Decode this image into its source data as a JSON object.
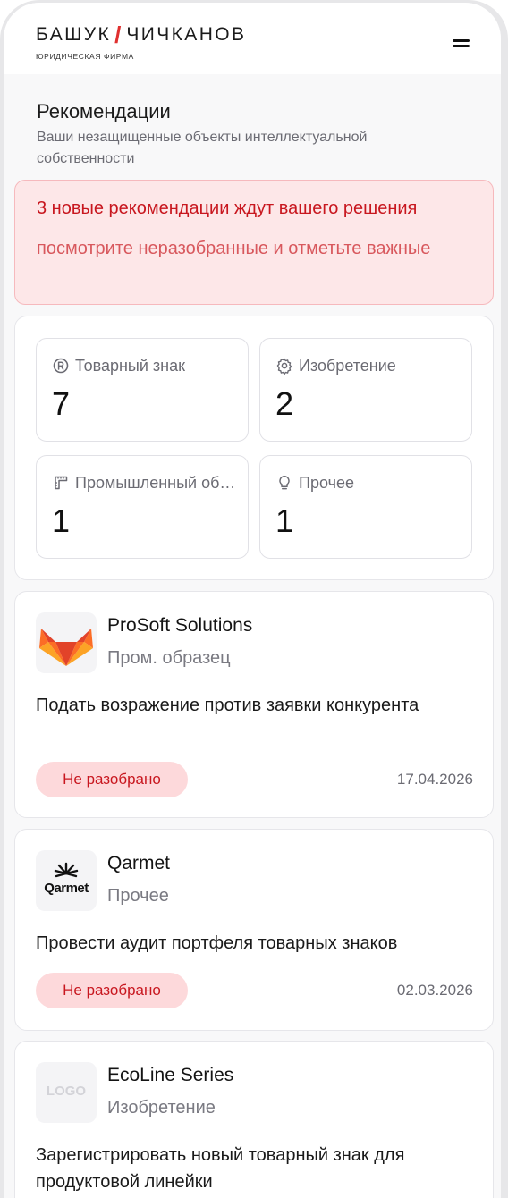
{
  "header": {
    "brand_left": "БАШУК",
    "brand_slash": "/",
    "brand_right": "ЧИЧКАНОВ",
    "brand_tagline": "ЮРИДИЧЕСКАЯ ФИРМА"
  },
  "page": {
    "title": "Рекомендации",
    "subtitle": "Ваши незащищенные объекты интеллектуальной собственности"
  },
  "alert": {
    "title": "3 новые рекомендации ждут вашего решения",
    "text": "посмотрите неразобранные и отметьте важные"
  },
  "stats": [
    {
      "icon": "registered-icon",
      "label": "Товарный знак",
      "value": "7"
    },
    {
      "icon": "gear-icon",
      "label": "Изобретение",
      "value": "2"
    },
    {
      "icon": "ruler-square-icon",
      "label": "Промышленный образец",
      "value": "1"
    },
    {
      "icon": "lightbulb-icon",
      "label": "Прочее",
      "value": "1"
    }
  ],
  "recommendations": [
    {
      "company": "ProSoft Solutions",
      "category": "Пром. образец",
      "description": "Подать возражение против заявки конкурента",
      "status": "Не разобрано",
      "date": "17.04.2026",
      "logo": "fox-logo"
    },
    {
      "company": "Qarmet",
      "logo_text": "Qarmet",
      "category": "Прочее",
      "description": "Провести аудит портфеля товарных знаков",
      "status": "Не разобрано",
      "date": "02.03.2026",
      "logo": "qarmet-logo"
    },
    {
      "company": "EcoLine Series",
      "logo_text": "LOGO",
      "category": "Изобретение",
      "description": "Зарегистрировать новый товарный знак для продуктовой линейки",
      "logo": "placeholder-logo"
    }
  ],
  "colors": {
    "accent_red": "#c8171f",
    "alert_bg": "#fde7e8",
    "badge_bg": "#fdd9db",
    "muted_text": "#6b6b73"
  }
}
